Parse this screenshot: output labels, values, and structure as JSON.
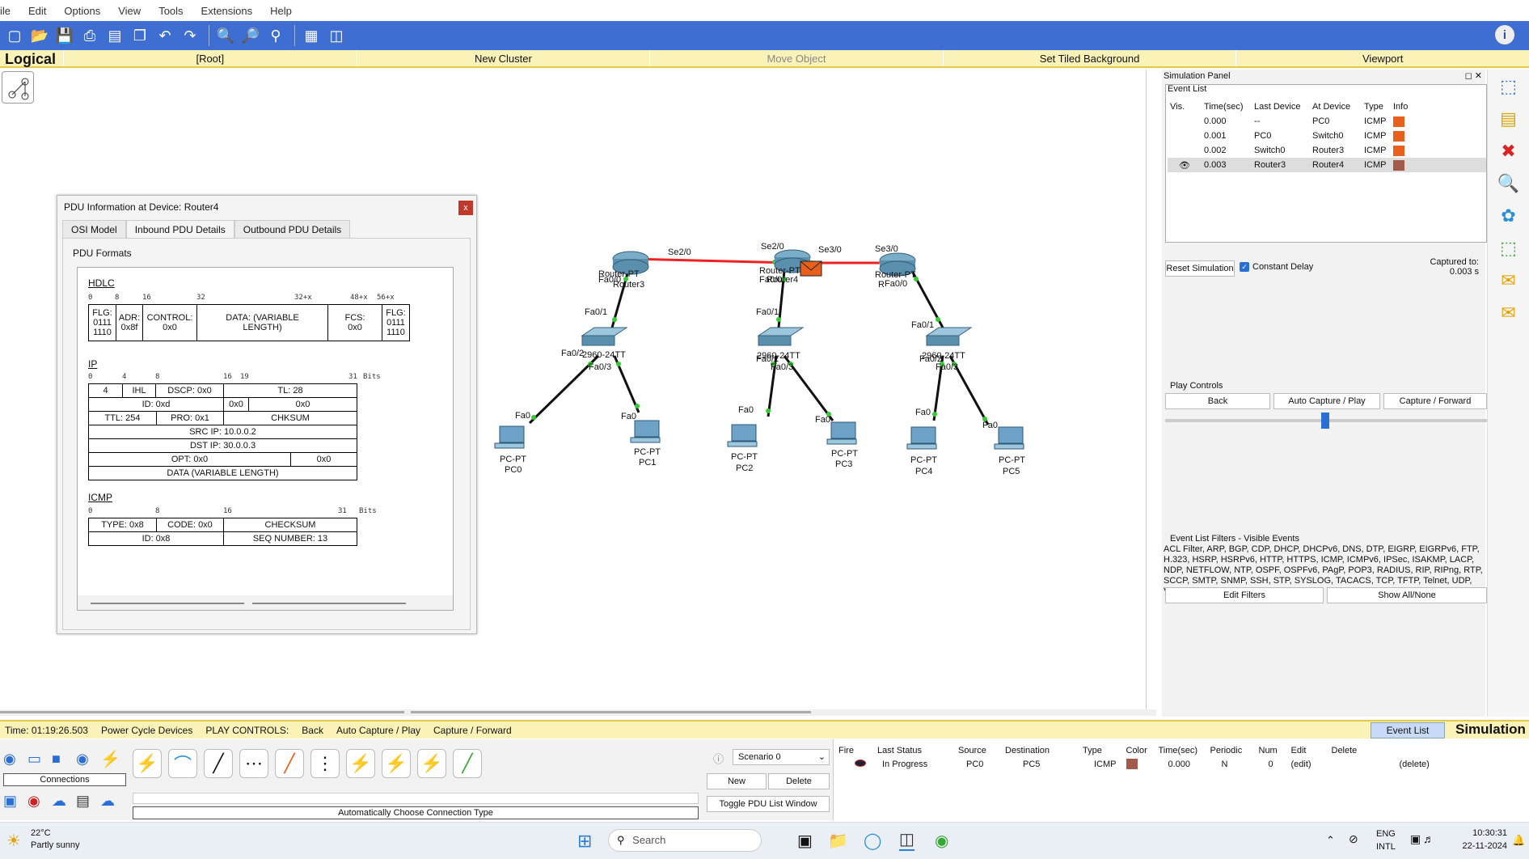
{
  "menu": [
    "ile",
    "Edit",
    "Options",
    "View",
    "Tools",
    "Extensions",
    "Help"
  ],
  "nav": {
    "logical": "Logical",
    "root": "[Root]",
    "new_cluster": "New Cluster",
    "move_object": "Move Object",
    "set_bg": "Set Tiled Background",
    "viewport": "Viewport"
  },
  "pdu": {
    "title": "PDU Information at Device: Router4",
    "close": "x",
    "tabs": [
      "OSI Model",
      "Inbound PDU Details",
      "Outbound PDU Details"
    ],
    "legend": "PDU Formats",
    "hdlc": {
      "header": "HDLC",
      "bits": [
        "0",
        "8",
        "16",
        "32",
        "32+x",
        "48+x",
        "56+x"
      ],
      "cells": [
        "FLG:\n0111\n1110",
        "ADR:\n0x8f",
        "CONTROL:\n0x0",
        "DATA: (VARIABLE\nLENGTH)",
        "FCS:\n0x0",
        "FLG:\n0111\n1110"
      ]
    },
    "ip": {
      "header": "IP",
      "bits": [
        "0",
        "4",
        "8",
        "16",
        "19",
        "31",
        "Bits"
      ],
      "cells": [
        "4",
        "IHL",
        "DSCP: 0x0",
        "TL: 28",
        "ID: 0xd",
        "0x0",
        "0x0",
        "TTL: 254",
        "PRO: 0x1",
        "CHKSUM",
        "SRC IP: 10.0.0.2",
        "DST IP: 30.0.0.3",
        "OPT: 0x0",
        "0x0",
        "DATA (VARIABLE LENGTH)"
      ]
    },
    "icmp": {
      "header": "ICMP",
      "bits": [
        "0",
        "8",
        "16",
        "31",
        "Bits"
      ],
      "cells": [
        "TYPE: 0x8",
        "CODE: 0x0",
        "CHECKSUM",
        "ID: 0x8",
        "SEQ NUMBER: 13"
      ]
    }
  },
  "network": {
    "devices": [
      "Router-PT",
      "Router3",
      "Router-PT",
      "Router4",
      "Router-PT",
      "R",
      "2960-24TT",
      "2960-24TT",
      "2960-24TT",
      "PC-PT",
      "PC0",
      "PC-PT",
      "PC1",
      "PC-PT",
      "PC2",
      "PC-PT",
      "PC3",
      "PC-PT",
      "PC4",
      "PC-PT",
      "PC5"
    ],
    "ports": [
      "Se2/0",
      "Se2/0",
      "Se3/0",
      "Se3/0",
      "Fa0/0",
      "Fa0/0",
      "Fa0/0",
      "Fa0/1",
      "Fa0/1",
      "Fa0/1",
      "Fa0/2",
      "Fa0/3",
      "Fa0/2",
      "Fa0/3",
      "Fa0/2",
      "Fa0/3",
      "Fa0",
      "Fa0",
      "Fa0",
      "Fa0",
      "Fa0",
      "Fa0",
      "S",
      "S"
    ]
  },
  "sim": {
    "title": "Simulation Panel",
    "event_list": "Event List",
    "cols": [
      "Vis.",
      "Time(sec)",
      "Last Device",
      "At Device",
      "Type",
      "Info"
    ],
    "events": [
      {
        "time": "0.000",
        "last": "--",
        "at": "PC0",
        "type": "ICMP",
        "color": "#e8601c"
      },
      {
        "time": "0.001",
        "last": "PC0",
        "at": "Switch0",
        "type": "ICMP",
        "color": "#e8601c"
      },
      {
        "time": "0.002",
        "last": "Switch0",
        "at": "Router3",
        "type": "ICMP",
        "color": "#e8601c"
      },
      {
        "time": "0.003",
        "last": "Router3",
        "at": "Router4",
        "type": "ICMP",
        "color": "#a35a4a"
      }
    ],
    "reset": "Reset Simulation",
    "constant_delay": "Constant Delay",
    "captured_to": "Captured to:",
    "captured_val": "0.003 s",
    "play_controls": "Play Controls",
    "back": "Back",
    "auto": "Auto Capture / Play",
    "capture": "Capture / Forward",
    "filters_title": "Event List Filters - Visible Events",
    "filters": "ACL Filter, ARP, BGP, CDP, DHCP, DHCPv6, DNS, DTP, EIGRP, EIGRPv6, FTP, H.323, HSRP, HSRPv6, HTTP, HTTPS, ICMP, ICMPv6, IPSec, ISAKMP, LACP, NDP, NETFLOW, NTP, OSPF, OSPFv6, PAgP, POP3, RADIUS, RIP, RIPng, RTP, SCCP, SMTP, SNMP, SSH, STP, SYSLOG, TACACS, TCP, TFTP, Telnet, UDP, VTP",
    "edit_filters": "Edit Filters",
    "show_all": "Show All/None"
  },
  "status": {
    "time": "Time: 01:19:26.503",
    "power": "Power Cycle Devices",
    "play": "PLAY CONTROLS:",
    "back": "Back",
    "auto": "Auto Capture / Play",
    "capture": "Capture / Forward",
    "event_list": "Event List",
    "simulation": "Simulation"
  },
  "devices_panel": {
    "connections": "Connections",
    "auto_conn": "Automatically Choose Connection Type"
  },
  "scenario": {
    "name": "Scenario 0",
    "new": "New",
    "delete": "Delete",
    "toggle": "Toggle PDU List Window"
  },
  "pdu_list": {
    "cols": [
      "Fire",
      "Last Status",
      "Source",
      "Destination",
      "Type",
      "Color",
      "Time(sec)",
      "Periodic",
      "Num",
      "Edit",
      "Delete"
    ],
    "row": {
      "status": "In Progress",
      "source": "PC0",
      "dest": "PC5",
      "type": "ICMP",
      "color": "#a35a4a",
      "time": "0.000",
      "periodic": "N",
      "num": "0",
      "edit": "(edit)",
      "delete": "(delete)"
    }
  },
  "taskbar": {
    "temp": "22°C",
    "weather": "Partly sunny",
    "search": "Search",
    "lang1": "ENG",
    "lang2": "INTL",
    "time": "10:30:31",
    "date": "22-11-2024"
  }
}
